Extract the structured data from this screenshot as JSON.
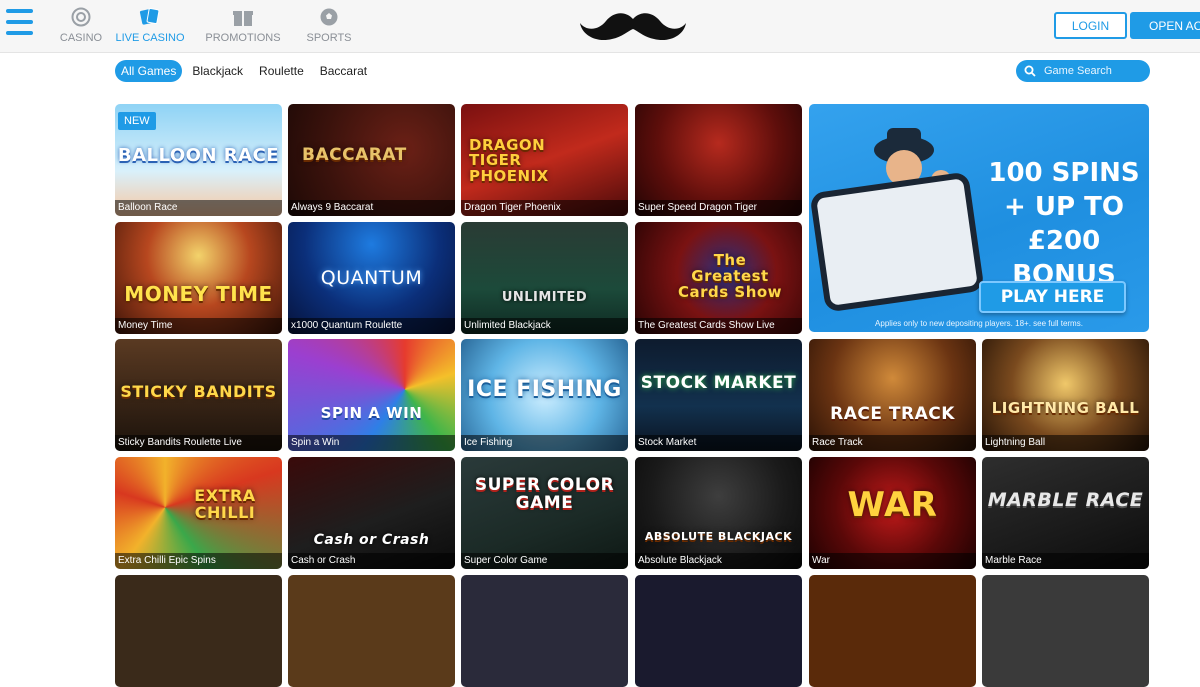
{
  "header": {
    "nav": [
      {
        "label": "CASINO",
        "icon": "casino-chip-icon",
        "active": false
      },
      {
        "label": "LIVE CASINO",
        "icon": "cards-icon",
        "active": true
      },
      {
        "label": "PROMOTIONS",
        "icon": "gift-icon",
        "active": false
      },
      {
        "label": "SPORTS",
        "icon": "soccer-ball-icon",
        "active": false
      }
    ],
    "logo": "mustache-logo",
    "login_label": "LOGIN",
    "open_account_label": "OPEN ACCO"
  },
  "filters": [
    "All Games",
    "Blackjack",
    "Roulette",
    "Baccarat"
  ],
  "search": {
    "placeholder": "Game Search"
  },
  "tiles": [
    {
      "caption": "Balloon Race",
      "art_text": "BALLOON RACE",
      "badge": "NEW"
    },
    {
      "caption": "Always 9 Baccarat",
      "art_text": "BACCARAT"
    },
    {
      "caption": "Dragon Tiger Phoenix",
      "art_text": "DRAGON TIGER PHOENIX"
    },
    {
      "caption": "Super Speed Dragon Tiger",
      "art_text": ""
    },
    {
      "caption": "Money Time",
      "art_text": "MONEY TIME"
    },
    {
      "caption": "x1000 Quantum Roulette",
      "art_text": "QUANTUM"
    },
    {
      "caption": "Unlimited Blackjack",
      "art_text": "UNLIMITED"
    },
    {
      "caption": "The Greatest Cards Show Live",
      "art_text": "The Greatest Cards Show"
    },
    {
      "caption": "Sticky Bandits Roulette Live",
      "art_text": "STICKY BANDITS"
    },
    {
      "caption": "Spin a Win",
      "art_text": "SPIN A WIN"
    },
    {
      "caption": "Ice Fishing",
      "art_text": "ICE FISHING"
    },
    {
      "caption": "Stock Market",
      "art_text": "STOCK MARKET"
    },
    {
      "caption": "Race Track",
      "art_text": "RACE TRACK"
    },
    {
      "caption": "Lightning Ball",
      "art_text": "LIGHTNING BALL"
    },
    {
      "caption": "Extra Chilli Epic Spins",
      "art_text": "EXTRA CHILLI"
    },
    {
      "caption": "Cash or Crash",
      "art_text": "Cash or Crash"
    },
    {
      "caption": "Super Color Game",
      "art_text": "SUPER COLOR GAME"
    },
    {
      "caption": "Absolute Blackjack",
      "art_text": "ABSOLUTE BLACKJACK"
    },
    {
      "caption": "War",
      "art_text": "WAR"
    },
    {
      "caption": "Marble Race",
      "art_text": "MARBLE RACE"
    }
  ],
  "promo": {
    "line1": "100 SPINS",
    "line2": "+ UP TO £200",
    "line3": "BONUS",
    "cta": "PLAY HERE",
    "terms": "Applies only to new depositing players. 18+. see full terms."
  },
  "colors": {
    "accent": "#1f9be6"
  }
}
